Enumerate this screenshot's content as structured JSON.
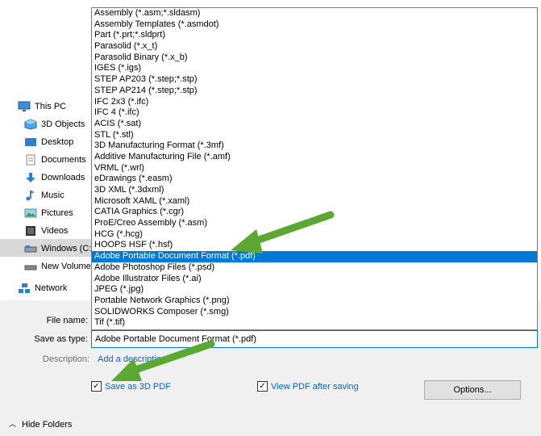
{
  "nav": {
    "items": [
      {
        "label": "This PC",
        "icon": "monitor-icon"
      },
      {
        "label": "3D Objects",
        "icon": "cube-icon"
      },
      {
        "label": "Desktop",
        "icon": "desktop-icon"
      },
      {
        "label": "Documents",
        "icon": "documents-icon"
      },
      {
        "label": "Downloads",
        "icon": "download-icon"
      },
      {
        "label": "Music",
        "icon": "music-icon"
      },
      {
        "label": "Pictures",
        "icon": "pictures-icon"
      },
      {
        "label": "Videos",
        "icon": "videos-icon"
      },
      {
        "label": "Windows (C:)",
        "icon": "drive-icon"
      },
      {
        "label": "New Volume",
        "icon": "drive-icon"
      },
      {
        "label": "Network",
        "icon": "network-icon"
      }
    ]
  },
  "file_types": [
    "Assembly (*.asm;*.sldasm)",
    "Assembly Templates (*.asmdot)",
    "Part (*.prt;*.sldprt)",
    "Parasolid (*.x_t)",
    "Parasolid Binary (*.x_b)",
    "IGES (*.igs)",
    "STEP AP203 (*.step;*.stp)",
    "STEP AP214 (*.step;*.stp)",
    "IFC 2x3 (*.ifc)",
    "IFC 4 (*.ifc)",
    "ACIS (*.sat)",
    "STL (*.stl)",
    "3D Manufacturing Format (*.3mf)",
    "Additive Manufacturing File (*.amf)",
    "VRML (*.wrl)",
    "eDrawings (*.easm)",
    "3D XML (*.3dxml)",
    "Microsoft XAML (*.xaml)",
    "CATIA Graphics (*.cgr)",
    "ProE/Creo Assembly (*.asm)",
    "HCG (*.hcg)",
    "HOOPS HSF (*.hsf)",
    "Adobe Portable Document Format (*.pdf)",
    "Adobe Photoshop Files  (*.psd)",
    "Adobe Illustrator Files (*.ai)",
    "JPEG (*.jpg)",
    "Portable Network Graphics (*.png)",
    "SOLIDWORKS Composer (*.smg)",
    "Tif (*.tif)"
  ],
  "selected_index": 22,
  "form": {
    "file_name_label": "File name:",
    "save_type_label": "Save as type:",
    "save_type_value": "Adobe Portable Document Format (*.pdf)",
    "description_label": "Description:",
    "description_link": "Add a descriptio"
  },
  "options": {
    "save_3d_pdf": "Save as 3D PDF",
    "save_3d_pdf_checked": true,
    "view_after": "View PDF after saving",
    "view_after_checked": true,
    "options_button": "Options..."
  },
  "hide_folders": "Hide Folders",
  "colors": {
    "selection": "#0078d7",
    "arrow": "#5aa832",
    "link": "#0066cc"
  }
}
